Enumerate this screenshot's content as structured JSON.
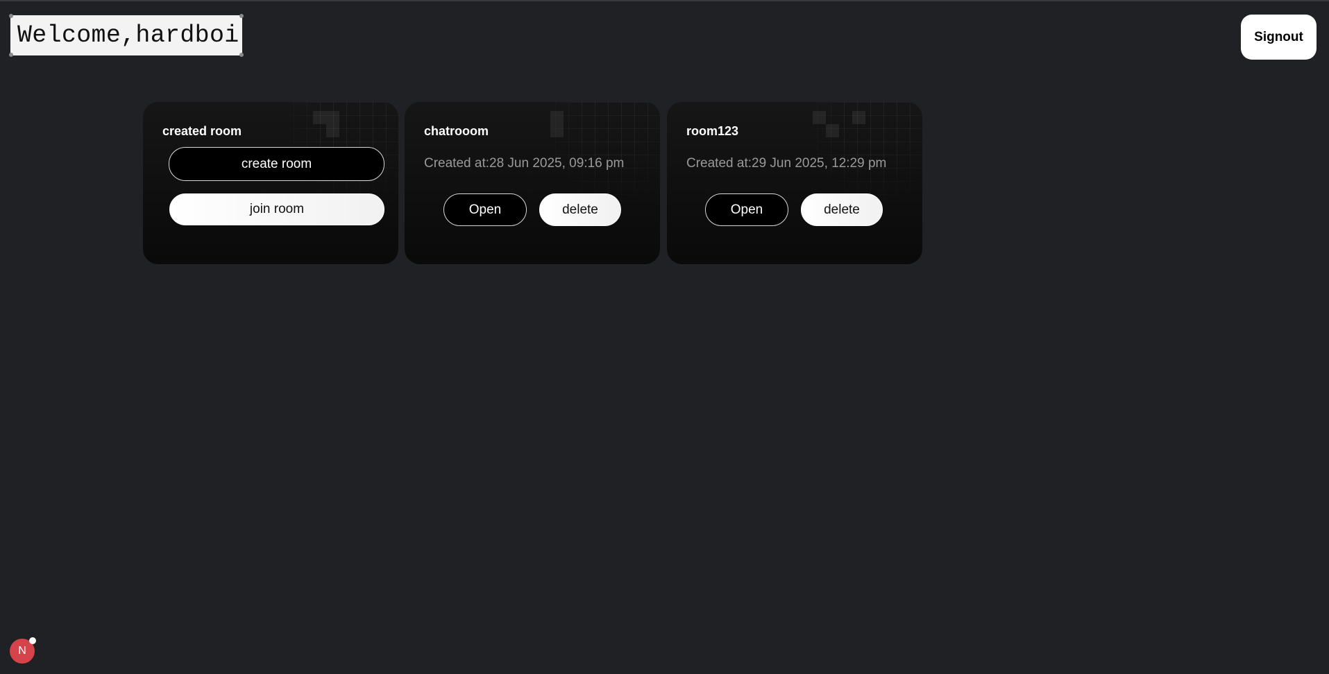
{
  "header": {
    "welcome_text": "Welcome,hardboi",
    "signout_label": "Signout"
  },
  "actions_card": {
    "title": "created room",
    "create_label": "create room",
    "join_label": "join room"
  },
  "rooms": [
    {
      "name": "chatrooom",
      "created": "Created at:28 Jun 2025, 09:16 pm",
      "open_label": "Open",
      "delete_label": "delete"
    },
    {
      "name": "room123",
      "created": "Created at:29 Jun 2025, 12:29 pm",
      "open_label": "Open",
      "delete_label": "delete"
    }
  ],
  "dev_badge": {
    "letter": "N",
    "icon": "nextjs-devtools-icon"
  },
  "colors": {
    "background": "#202124",
    "card": "#121212",
    "accent_light": "#ffffff",
    "badge": "#d6434a"
  }
}
